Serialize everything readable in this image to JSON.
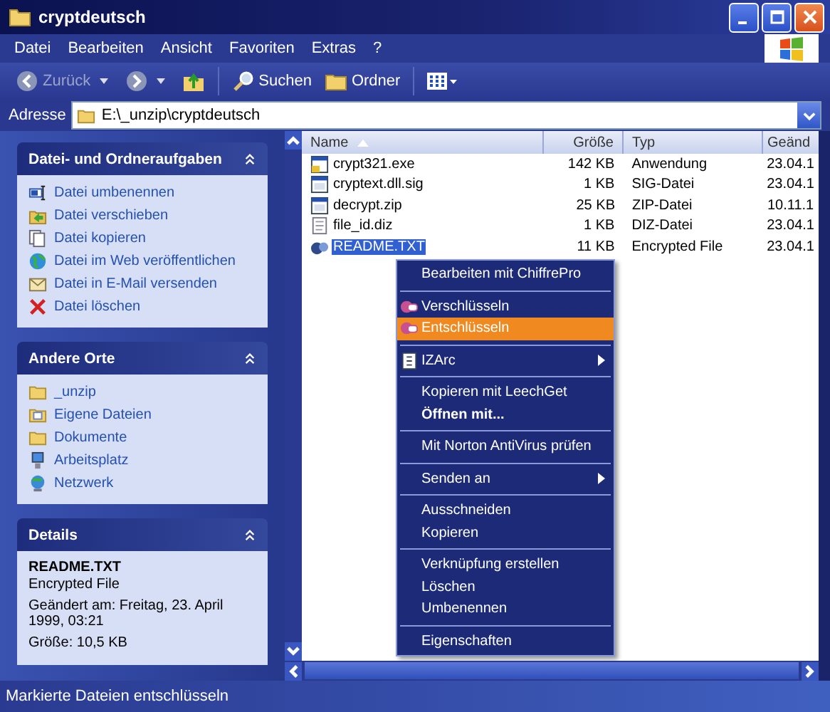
{
  "window": {
    "title": "cryptdeutsch"
  },
  "menu_bar": [
    "Datei",
    "Bearbeiten",
    "Ansicht",
    "Favoriten",
    "Extras",
    "?"
  ],
  "toolbar": {
    "back": {
      "label": "Zurück",
      "disabled": true
    },
    "search": "Suchen",
    "folders": "Ordner"
  },
  "address": {
    "label": "Adresse",
    "value": "E:\\_unzip\\cryptdeutsch"
  },
  "task_panes": [
    {
      "title": "Datei- und Ordneraufgaben",
      "items": [
        {
          "label": "Datei umbenennen",
          "kind": "rename"
        },
        {
          "label": "Datei verschieben",
          "kind": "move"
        },
        {
          "label": "Datei kopieren",
          "kind": "copy"
        },
        {
          "label": "Datei im Web veröffentlichen",
          "kind": "web"
        },
        {
          "label": "Datei in E-Mail versenden",
          "kind": "mail"
        },
        {
          "label": "Datei löschen",
          "kind": "delete"
        }
      ]
    },
    {
      "title": "Andere Orte",
      "items": [
        {
          "label": "_unzip",
          "kind": "folder"
        },
        {
          "label": "Eigene Dateien",
          "kind": "documents"
        },
        {
          "label": "Dokumente",
          "kind": "folder"
        },
        {
          "label": "Arbeitsplatz",
          "kind": "computer"
        },
        {
          "label": "Netzwerk",
          "kind": "network"
        }
      ]
    }
  ],
  "details": {
    "title": "Details",
    "name": "README.TXT",
    "type": "Encrypted File",
    "modified": "Geändert am: Freitag, 23. April 1999, 03:21",
    "size": "Größe: 10,5 KB"
  },
  "file_list": {
    "columns": [
      {
        "label": "Name",
        "sorted": true
      },
      {
        "label": "Größe",
        "sorted": false
      },
      {
        "label": "Typ",
        "sorted": false
      },
      {
        "label": "Geänd",
        "sorted": false
      }
    ],
    "rows": [
      {
        "name": "crypt321.exe",
        "kind": "program",
        "size": "142 KB",
        "type": "Anwendung",
        "date": "23.04.1",
        "selected": false
      },
      {
        "name": "cryptext.dll.sig",
        "kind": "file",
        "size": "1 KB",
        "type": "SIG-Datei",
        "date": "23.04.1",
        "selected": false
      },
      {
        "name": "decrypt.zip",
        "kind": "file",
        "size": "25 KB",
        "type": "ZIP-Datei",
        "date": "10.11.1",
        "selected": false
      },
      {
        "name": "file_id.diz",
        "kind": "text",
        "size": "1 KB",
        "type": "DIZ-Datei",
        "date": "23.04.1",
        "selected": false
      },
      {
        "name": "README.TXT",
        "kind": "encrypted",
        "size": "11 KB",
        "type": "Encrypted File",
        "date": "23.04.1",
        "selected": true
      }
    ]
  },
  "context_menu": [
    [
      {
        "label": "Bearbeiten mit ChiffrePro",
        "kind": "plain",
        "selected": false
      }
    ],
    [
      {
        "label": "Verschlüsseln",
        "kind": "crypto",
        "selected": false
      },
      {
        "label": "Entschlüsseln",
        "kind": "crypto",
        "selected": true
      }
    ],
    [
      {
        "label": "IZArc",
        "kind": "archive",
        "submenu": true,
        "selected": false
      }
    ],
    [
      {
        "label": "Kopieren mit LeechGet",
        "kind": "plain",
        "bold": false,
        "selected": false
      },
      {
        "label": "Öffnen mit...",
        "kind": "plain",
        "bold": true,
        "selected": false
      }
    ],
    [
      {
        "label": "Mit Norton AntiVirus prüfen",
        "kind": "plain",
        "selected": false
      }
    ],
    [
      {
        "label": "Senden an",
        "kind": "plain",
        "submenu": true,
        "selected": false
      }
    ],
    [
      {
        "label": "Ausschneiden",
        "kind": "plain",
        "selected": false
      },
      {
        "label": "Kopieren",
        "kind": "plain",
        "selected": false
      }
    ],
    [
      {
        "label": "Verknüpfung erstellen",
        "kind": "plain",
        "selected": false
      },
      {
        "label": "Löschen",
        "kind": "plain",
        "selected": false
      },
      {
        "label": "Umbenennen",
        "kind": "plain",
        "selected": false
      }
    ],
    [
      {
        "label": "Eigenschaften",
        "kind": "plain",
        "selected": false
      }
    ]
  ],
  "status_bar": "Markierte Dateien entschlüsseln"
}
